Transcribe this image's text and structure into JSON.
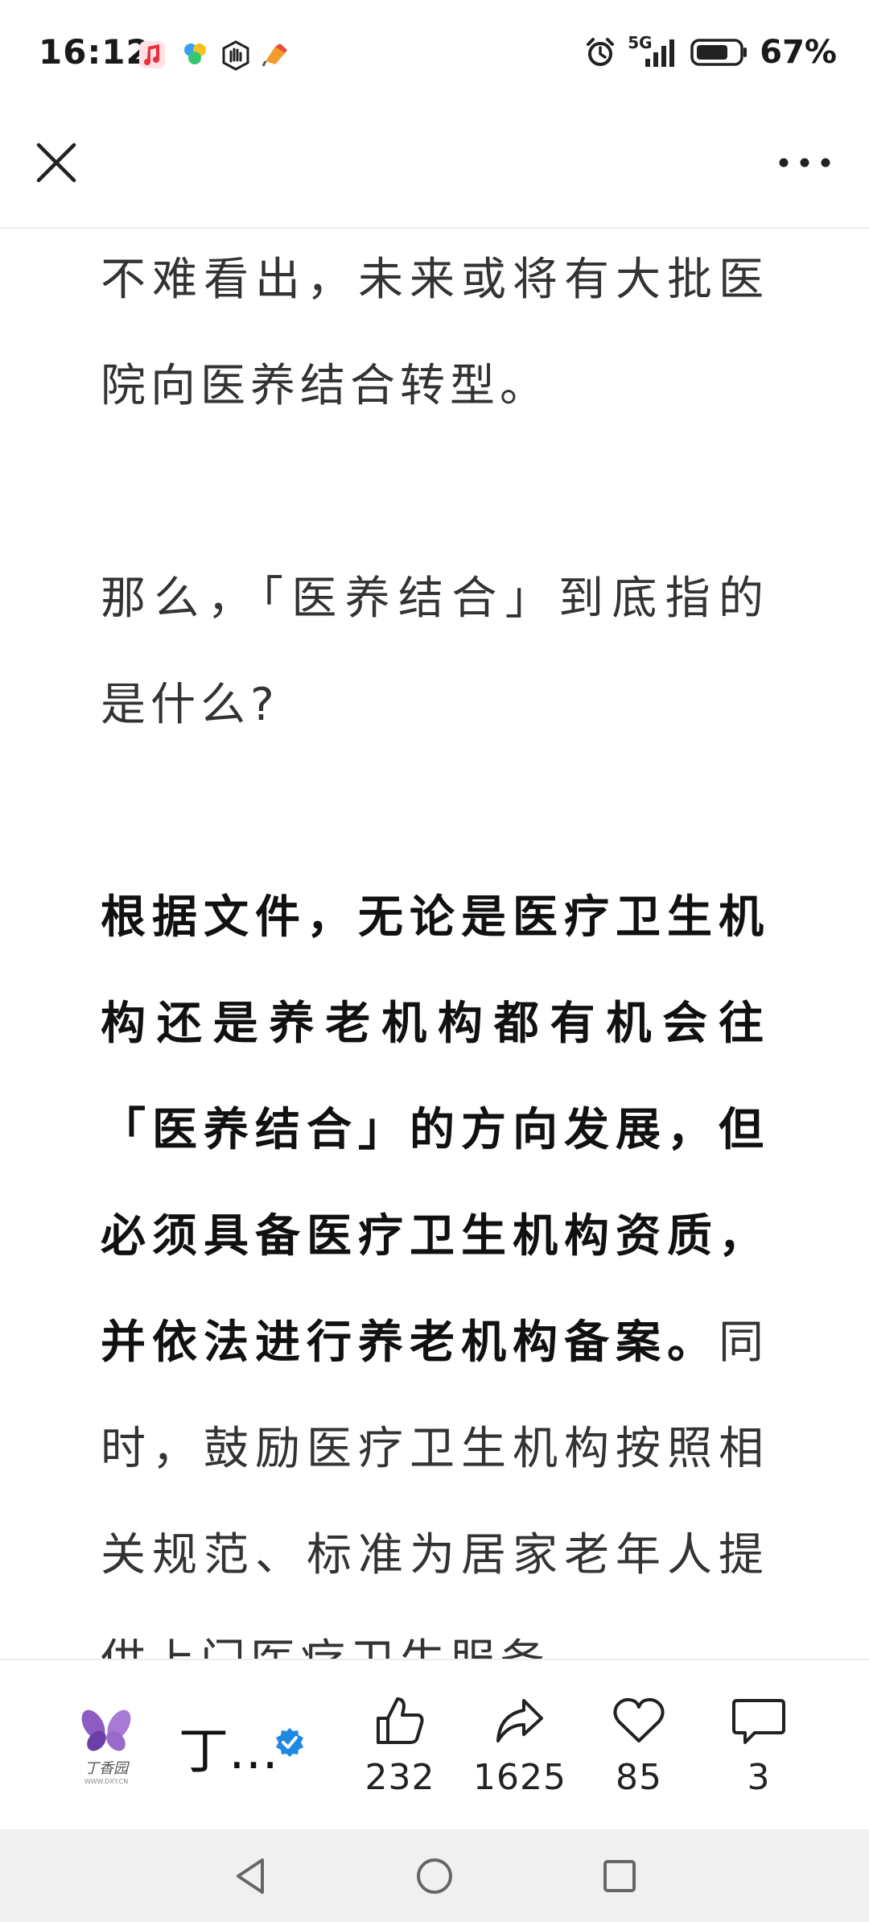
{
  "status_bar": {
    "time": "16:12",
    "network": "5G",
    "battery": "67%"
  },
  "app_bar": {
    "close_icon": "close-icon",
    "more_icon": "more-icon"
  },
  "article": {
    "p1": "不难看出，未来或将有大批医院向医养结合转型。",
    "p2": "那么，「医养结合」到底指的是什么?",
    "p3_bold": "根据文件，无论是医疗卫生机构还是养老机构都有机会往「医养结合」的方向发展，但必须具备医疗卫生机构资质，并依法进行养老机构备案。",
    "p3_rest": "同时，鼓励医疗卫生机构按照相关规范、标准为居家老年人提供上门医疗卫生服务。"
  },
  "bottom_bar": {
    "author_name": "丁…",
    "logo_text": "丁香园",
    "logo_subtext": "WWW.DXY.CN",
    "likes": "232",
    "shares": "1625",
    "favorites": "85",
    "comments": "3"
  },
  "colors": {
    "verified_blue": "#1E88E5",
    "logo_purple": "#8E5BC2"
  }
}
